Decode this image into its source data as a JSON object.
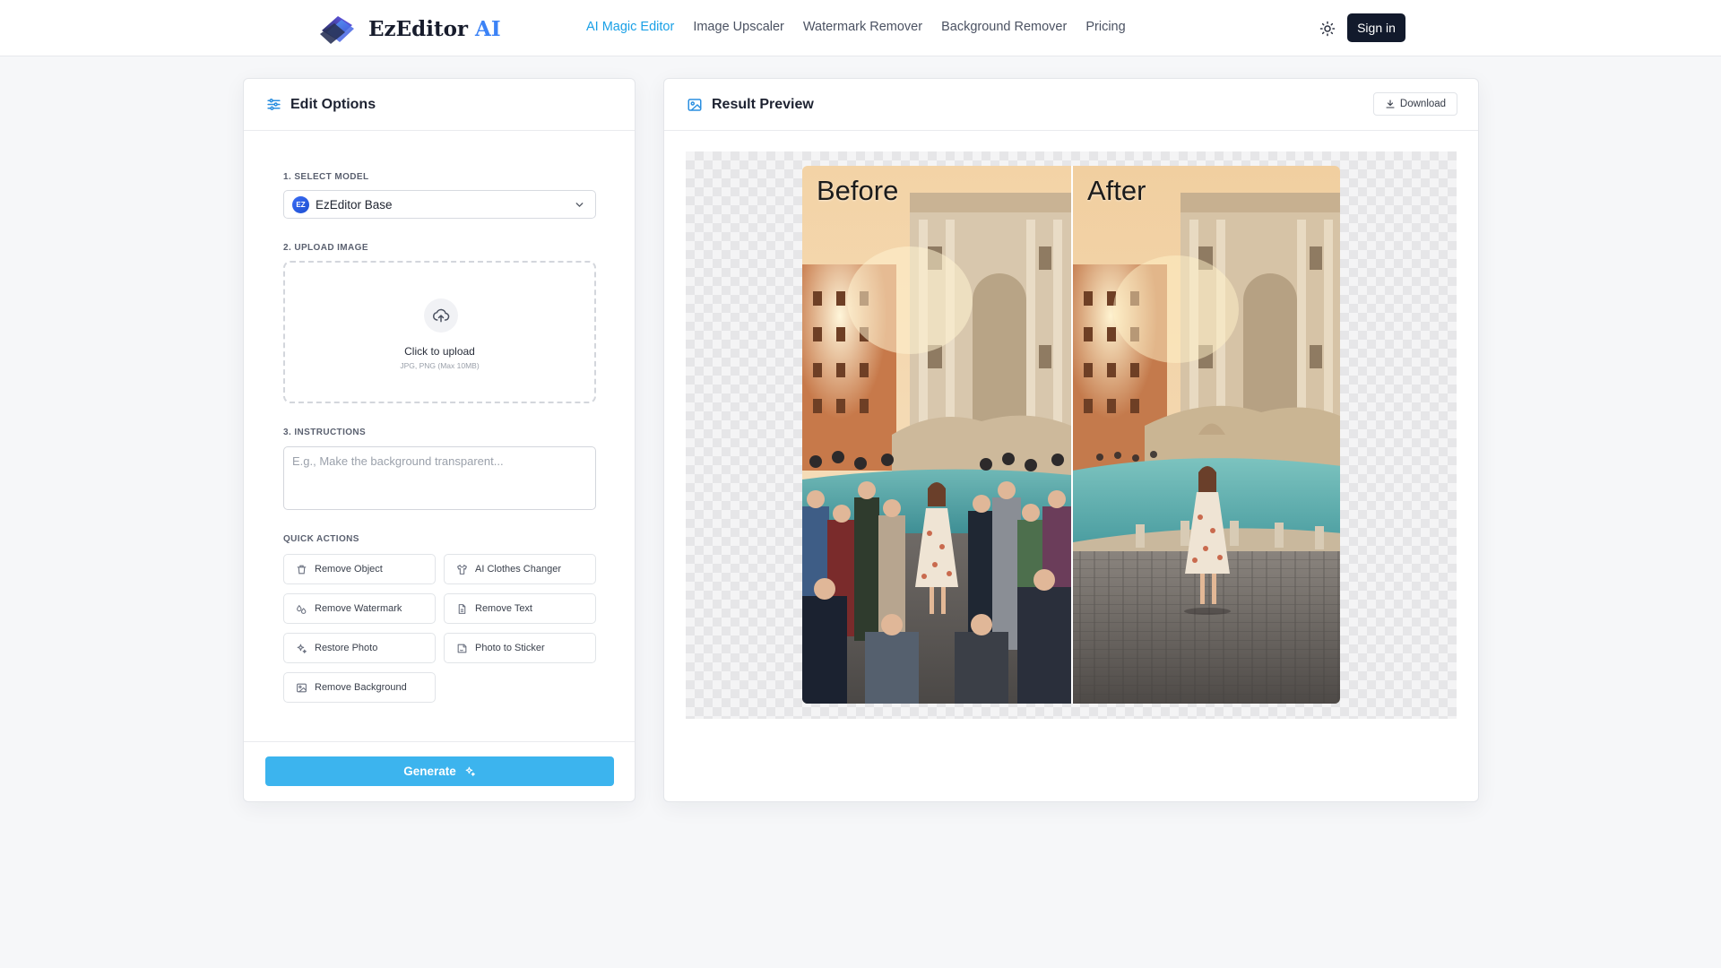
{
  "header": {
    "brand_main": "EzEditor",
    "brand_accent": "AI",
    "nav": [
      {
        "label": "AI Magic Editor",
        "active": true
      },
      {
        "label": "Image Upscaler",
        "active": false
      },
      {
        "label": "Watermark Remover",
        "active": false
      },
      {
        "label": "Background Remover",
        "active": false
      },
      {
        "label": "Pricing",
        "active": false
      }
    ],
    "theme_icon": "sun-icon",
    "signin_label": "Sign in"
  },
  "edit_options": {
    "title": "Edit Options",
    "step1_label": "1. SELECT MODEL",
    "model_badge": "EZ",
    "model_selected": "EzEditor Base",
    "step2_label": "2. UPLOAD IMAGE",
    "upload_title": "Click to upload",
    "upload_sub": "JPG, PNG (Max 10MB)",
    "step3_label": "3. INSTRUCTIONS",
    "instructions_placeholder": "E.g., Make the background transparent...",
    "instructions_value": "",
    "quick_actions_label": "QUICK ACTIONS",
    "quick_actions": [
      {
        "label": "Remove Object",
        "icon": "trash-icon"
      },
      {
        "label": "AI Clothes Changer",
        "icon": "shirt-icon"
      },
      {
        "label": "Remove Watermark",
        "icon": "droplets-icon"
      },
      {
        "label": "Remove Text",
        "icon": "file-text-icon"
      },
      {
        "label": "Restore Photo",
        "icon": "sparkles-icon"
      },
      {
        "label": "Photo to Sticker",
        "icon": "sticker-icon"
      },
      {
        "label": "Remove Background",
        "icon": "image-icon"
      }
    ],
    "generate_label": "Generate"
  },
  "result_preview": {
    "title": "Result Preview",
    "download_label": "Download",
    "before_label": "Before",
    "after_label": "After"
  },
  "colors": {
    "accent": "#1aa0e6",
    "generate": "#3cb4ee",
    "signin_bg": "#121a2c"
  }
}
